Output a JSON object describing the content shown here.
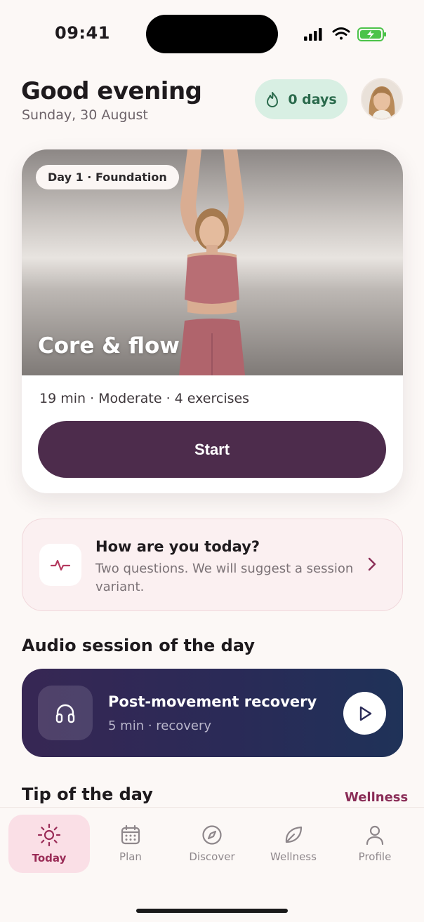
{
  "status_bar": {
    "time": "09:41"
  },
  "header": {
    "greeting": "Good evening",
    "date": "Sunday, 30 August",
    "streak": "0 days",
    "streak_icon": "flame-icon"
  },
  "hero": {
    "chip": "Day 1 · Foundation",
    "title": "Core & flow",
    "meta": "19 min · Moderate · 4 exercises",
    "start_label": "Start"
  },
  "checkin": {
    "title": "How are you today?",
    "subtitle": "Two questions. We will suggest a session variant.",
    "icon": "pulse-icon"
  },
  "audio": {
    "section_title": "Audio session of the day",
    "title": "Post-movement recovery",
    "meta": "5 min · recovery",
    "icon": "headphones-icon"
  },
  "tip": {
    "section_title": "Tip of the day",
    "link": "Wellness"
  },
  "tabs": [
    {
      "label": "Today",
      "icon": "sun-icon",
      "active": true
    },
    {
      "label": "Plan",
      "icon": "calendar-icon",
      "active": false
    },
    {
      "label": "Discover",
      "icon": "compass-icon",
      "active": false
    },
    {
      "label": "Wellness",
      "icon": "leaf-icon",
      "active": false
    },
    {
      "label": "Profile",
      "icon": "person-icon",
      "active": false
    }
  ],
  "colors": {
    "background": "#fcf8f6",
    "primary": "#4d2c4c",
    "accent": "#9a2c57",
    "streak_bg": "#d8efe3",
    "audio_bg": "#2a2a57"
  }
}
